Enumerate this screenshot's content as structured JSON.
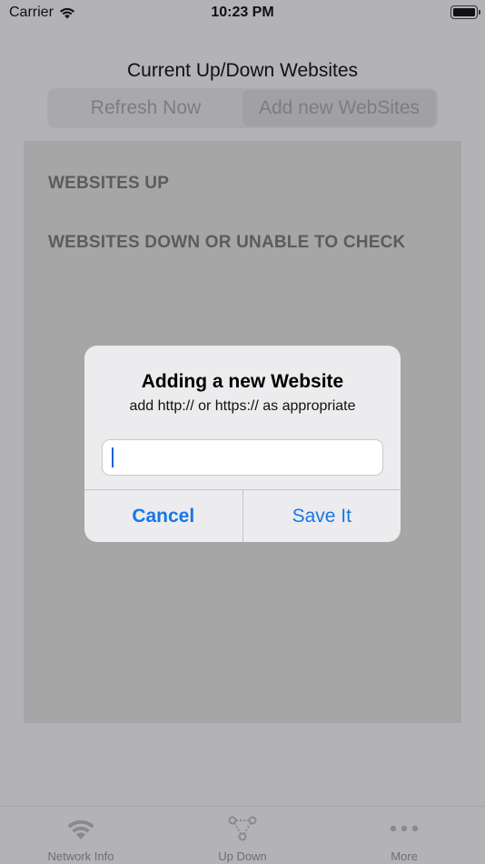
{
  "status_bar": {
    "carrier": "Carrier",
    "time": "10:23 PM"
  },
  "header": {
    "title": "Current Up/Down Websites",
    "segments": [
      "Refresh Now",
      "Add new WebSites"
    ]
  },
  "sections": {
    "up": "WEBSITES UP",
    "down": "WEBSITES DOWN OR UNABLE TO CHECK"
  },
  "alert": {
    "title": "Adding a new Website",
    "message": "add http:// or https:// as appropriate",
    "input_value": "",
    "cancel_label": "Cancel",
    "save_label": "Save It"
  },
  "tabbar": {
    "items": [
      {
        "label": "Network Info",
        "icon": "wifi-icon"
      },
      {
        "label": "Up Down",
        "icon": "network-nodes-icon"
      },
      {
        "label": "More",
        "icon": "more-dots-icon"
      }
    ]
  },
  "colors": {
    "accent": "#1677e6",
    "overlay": "#b2b2b7"
  }
}
